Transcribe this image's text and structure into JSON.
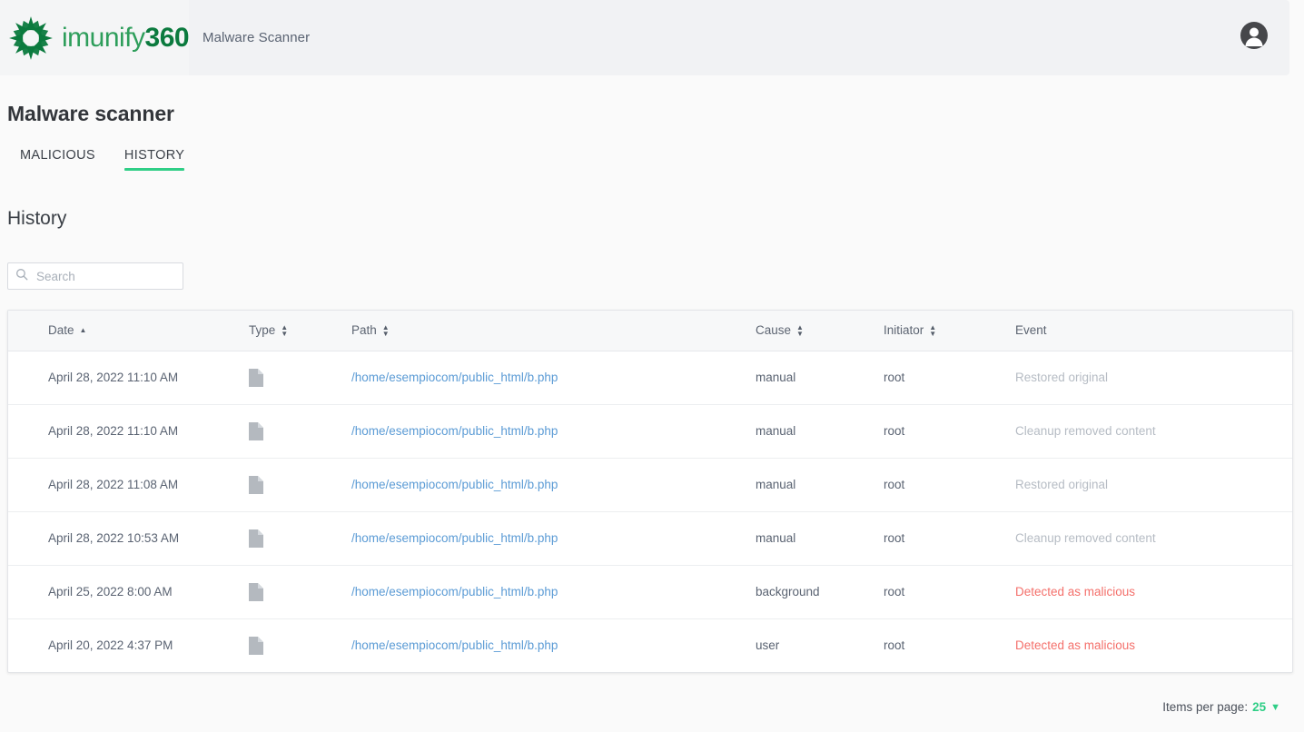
{
  "header": {
    "logo_name": "imunify",
    "logo_suffix": "360",
    "logo_icon": "imunify-star-logo",
    "app_title": "Malware Scanner",
    "avatar_icon": "user-avatar-icon"
  },
  "page": {
    "title": "Malware scanner",
    "section_title": "History"
  },
  "tabs": [
    {
      "label": "MALICIOUS",
      "active": false
    },
    {
      "label": "HISTORY",
      "active": true
    }
  ],
  "search": {
    "placeholder": "Search",
    "value": "",
    "icon": "search-icon"
  },
  "table": {
    "columns": [
      {
        "label": "Date",
        "sort": "asc"
      },
      {
        "label": "Type",
        "sort": "both"
      },
      {
        "label": "Path",
        "sort": "both"
      },
      {
        "label": "Cause",
        "sort": "both"
      },
      {
        "label": "Initiator",
        "sort": "both"
      },
      {
        "label": "Event",
        "sort": "none"
      }
    ],
    "rows": [
      {
        "date": "April 28, 2022 11:10 AM",
        "type_icon": "file-document-icon",
        "path": "/home/esempiocom/public_html/b.php",
        "cause": "manual",
        "initiator": "root",
        "event": "Restored original",
        "event_style": "muted"
      },
      {
        "date": "April 28, 2022 11:10 AM",
        "type_icon": "file-document-icon",
        "path": "/home/esempiocom/public_html/b.php",
        "cause": "manual",
        "initiator": "root",
        "event": "Cleanup removed content",
        "event_style": "muted"
      },
      {
        "date": "April 28, 2022 11:08 AM",
        "type_icon": "file-document-icon",
        "path": "/home/esempiocom/public_html/b.php",
        "cause": "manual",
        "initiator": "root",
        "event": "Restored original",
        "event_style": "muted"
      },
      {
        "date": "April 28, 2022 10:53 AM",
        "type_icon": "file-document-icon",
        "path": "/home/esempiocom/public_html/b.php",
        "cause": "manual",
        "initiator": "root",
        "event": "Cleanup removed content",
        "event_style": "muted"
      },
      {
        "date": "April 25, 2022 8:00 AM",
        "type_icon": "file-document-icon",
        "path": "/home/esempiocom/public_html/b.php",
        "cause": "background",
        "initiator": "root",
        "event": "Detected as malicious",
        "event_style": "danger"
      },
      {
        "date": "April 20, 2022 4:37 PM",
        "type_icon": "file-document-icon",
        "path": "/home/esempiocom/public_html/b.php",
        "cause": "user",
        "initiator": "root",
        "event": "Detected as malicious",
        "event_style": "danger"
      }
    ]
  },
  "footer": {
    "items_per_page_label": "Items per page:",
    "items_per_page_value": "25",
    "caret_icon": "chevron-down-icon"
  },
  "colors": {
    "brand_green": "#2e9e5b",
    "accent_green": "#2fce86",
    "link_blue": "#5b9bd5",
    "danger_red": "#f4706b",
    "muted_gray": "#b6bcc4",
    "page_bg": "#fafafa",
    "header_bg": "#f1f2f4"
  }
}
